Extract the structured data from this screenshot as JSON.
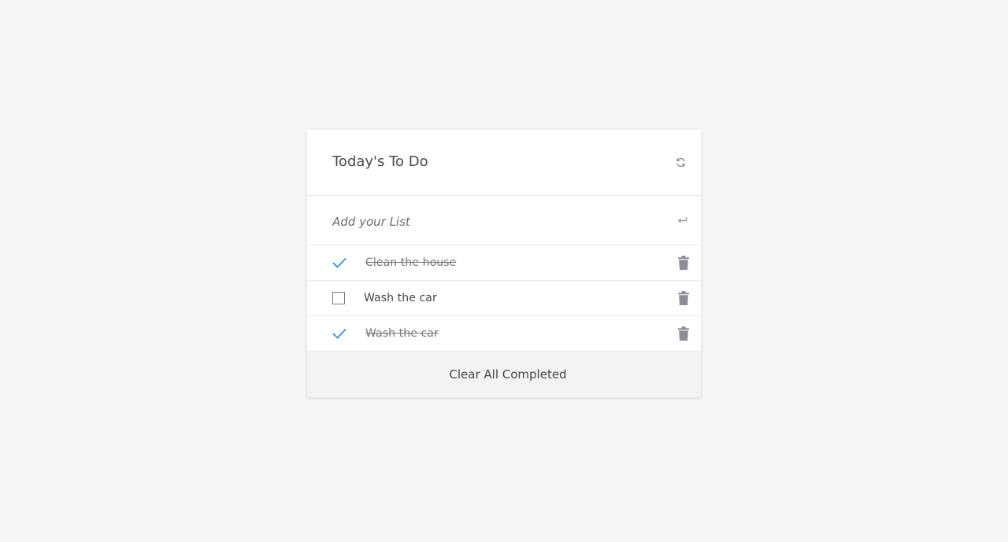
{
  "header": {
    "title": "Today's To Do",
    "refresh_icon": "refresh-icon"
  },
  "add": {
    "placeholder": "Add your List",
    "value": "",
    "enter_icon": "enter-return-icon"
  },
  "items": [
    {
      "label": "Clean the house",
      "completed": true
    },
    {
      "label": "Wash the car",
      "completed": false
    },
    {
      "label": "Wash the car",
      "completed": true
    }
  ],
  "footer": {
    "clear_label": "Clear All Completed"
  },
  "colors": {
    "background": "#f5f5f5",
    "card": "#ffffff",
    "check": "#2f8fdd",
    "trash": "#8e8c96",
    "footer_bg": "#f3f3f3"
  }
}
